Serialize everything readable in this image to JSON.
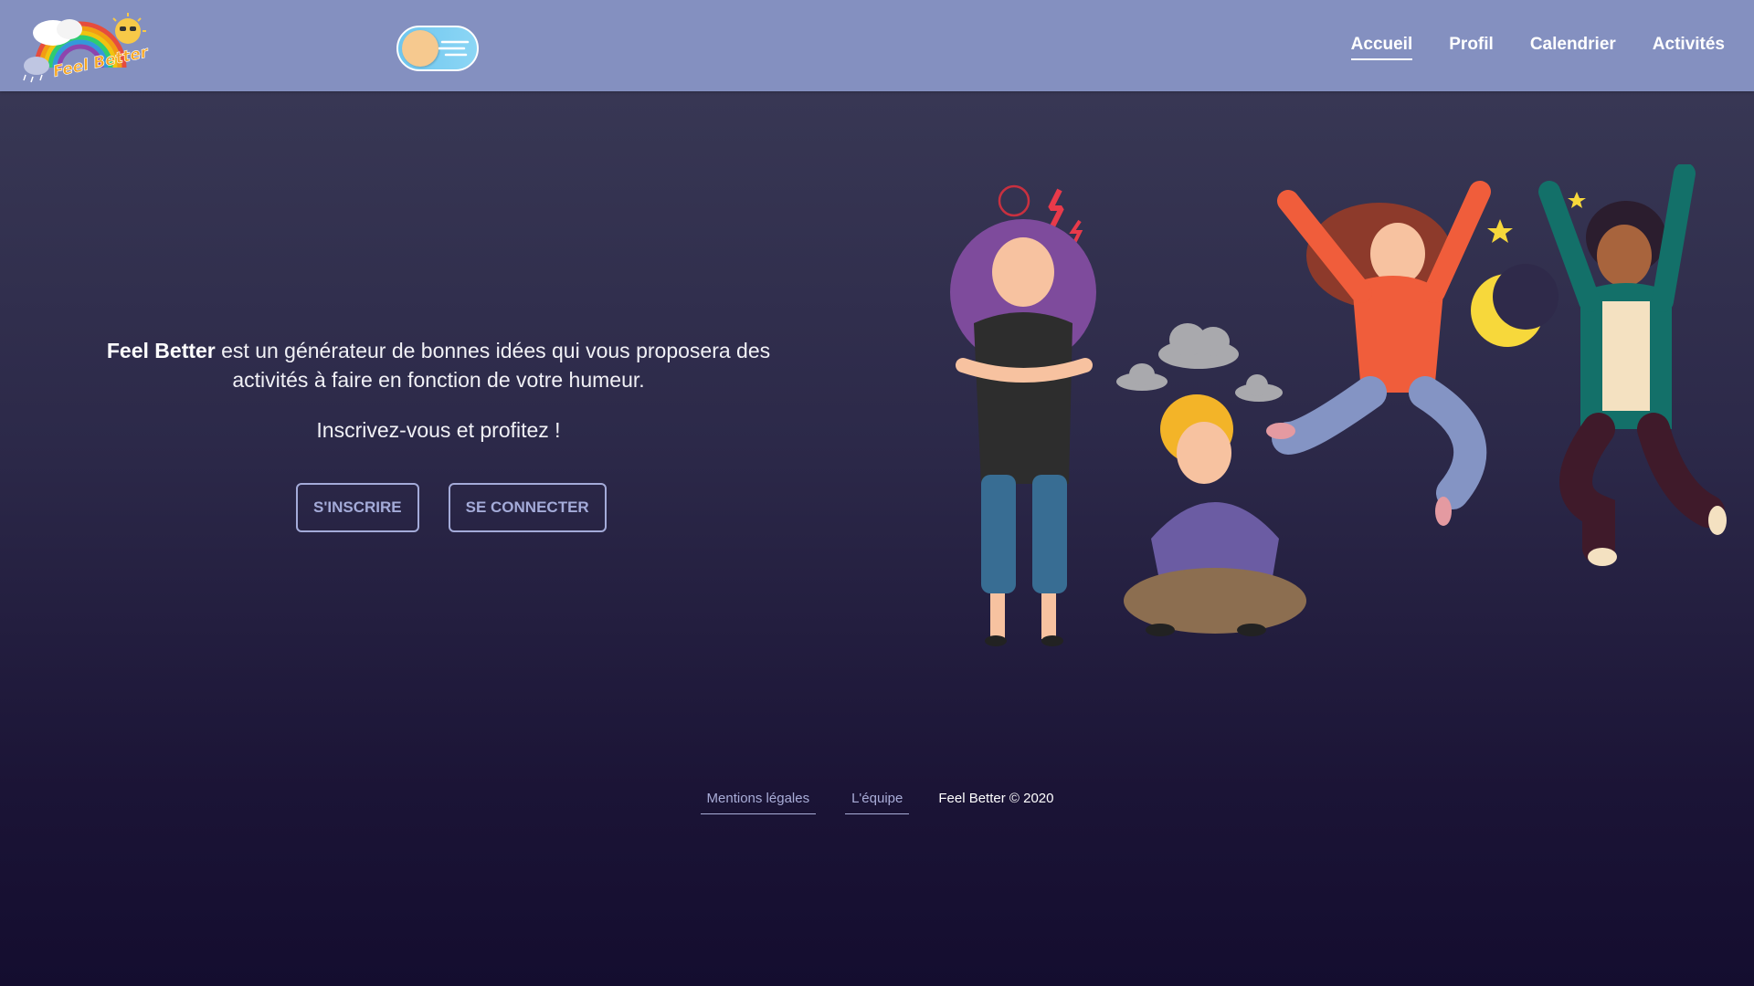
{
  "header": {
    "logo_text": "Feel Better",
    "theme_toggle_icon": "day-night-toggle-icon",
    "nav": [
      {
        "label": "Accueil",
        "active": true
      },
      {
        "label": "Profil",
        "active": false
      },
      {
        "label": "Calendrier",
        "active": false
      },
      {
        "label": "Activités",
        "active": false
      }
    ]
  },
  "main": {
    "intro_brand": "Feel Better",
    "intro_text": " est un générateur de bonnes idées qui vous proposera des activités à faire en fonction de votre humeur.",
    "cta_text": "Inscrivez-vous et profitez !",
    "signup_label": "S'INSCRIRE",
    "login_label": "SE CONNECTER",
    "illustration_icon": "moods-characters-illustration"
  },
  "footer": {
    "legal_label": "Mentions légales",
    "team_label": "L'équipe",
    "copyright": "Feel Better © 2020"
  },
  "colors": {
    "header_bg": "#8490c0",
    "button_border": "#a4abd9",
    "bg_top": "#3b3b57",
    "bg_bottom": "#140d2f"
  }
}
